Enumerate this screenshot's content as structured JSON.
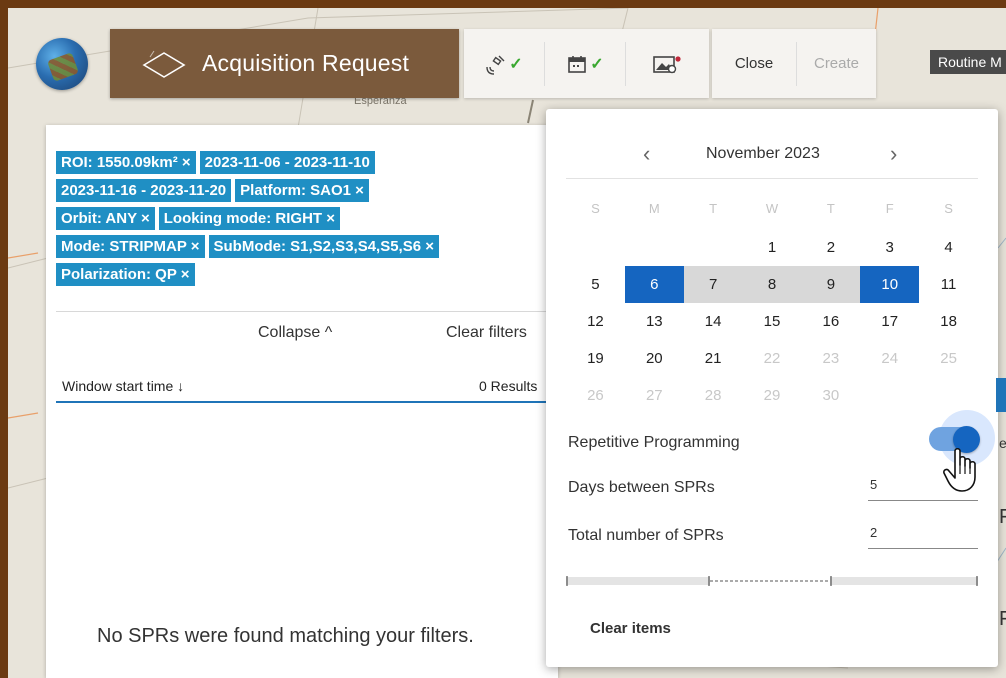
{
  "header": {
    "title": "Acquisition Request",
    "close_label": "Close",
    "create_label": "Create",
    "routine_label": "Routine M"
  },
  "map": {
    "place_label": "Esperanza"
  },
  "filters": {
    "chips": [
      [
        "ROI: 1550.09km² ×",
        "2023-11-06 - 2023-11-10"
      ],
      [
        "2023-11-16 - 2023-11-20",
        "Platform: SAO1 ×"
      ],
      [
        "Orbit: ANY ×",
        "Looking mode: RIGHT ×"
      ],
      [
        "Mode: STRIPMAP ×",
        "SubMode: S1,S2,S3,S4,S5,S6 ×"
      ],
      [
        "Polarization: QP ×"
      ]
    ],
    "collapse_label": "Collapse ^",
    "clear_filters_label": "Clear filters",
    "sort_label": "Window start time ↓",
    "results_label": "0 Results",
    "empty_message": "No SPRs were found matching your filters."
  },
  "calendar": {
    "month_label": "November 2023",
    "weekday_headers": [
      "S",
      "M",
      "T",
      "W",
      "T",
      "F",
      "S"
    ],
    "weeks": [
      [
        "",
        "",
        "",
        "1",
        "2",
        "3",
        "4"
      ],
      [
        "5",
        "6",
        "7",
        "8",
        "9",
        "10",
        "11"
      ],
      [
        "12",
        "13",
        "14",
        "15",
        "16",
        "17",
        "18"
      ],
      [
        "19",
        "20",
        "21",
        "22",
        "23",
        "24",
        "25"
      ],
      [
        "26",
        "27",
        "28",
        "29",
        "30",
        "",
        ""
      ]
    ],
    "selected_start": "6",
    "selected_end": "10",
    "range_days": [
      "7",
      "8",
      "9"
    ],
    "disabled_from_day": 22
  },
  "options": {
    "repetitive_label": "Repetitive Programming",
    "repetitive_on": true,
    "days_between_label": "Days between SPRs",
    "days_between_value": "5",
    "total_number_label": "Total number of SPRs",
    "total_number_value": "2",
    "clear_items_label": "Clear items"
  },
  "colors": {
    "chip_bg": "#1f8fc4",
    "selected_day": "#1565c0",
    "title_bar": "#7b5a3c",
    "frame_border": "#6b3a12"
  },
  "icons": [
    "satellite-icon",
    "calendar-icon",
    "image-settings-icon",
    "check-icon",
    "chevron-left-icon",
    "chevron-right-icon",
    "hand-cursor-icon"
  ]
}
